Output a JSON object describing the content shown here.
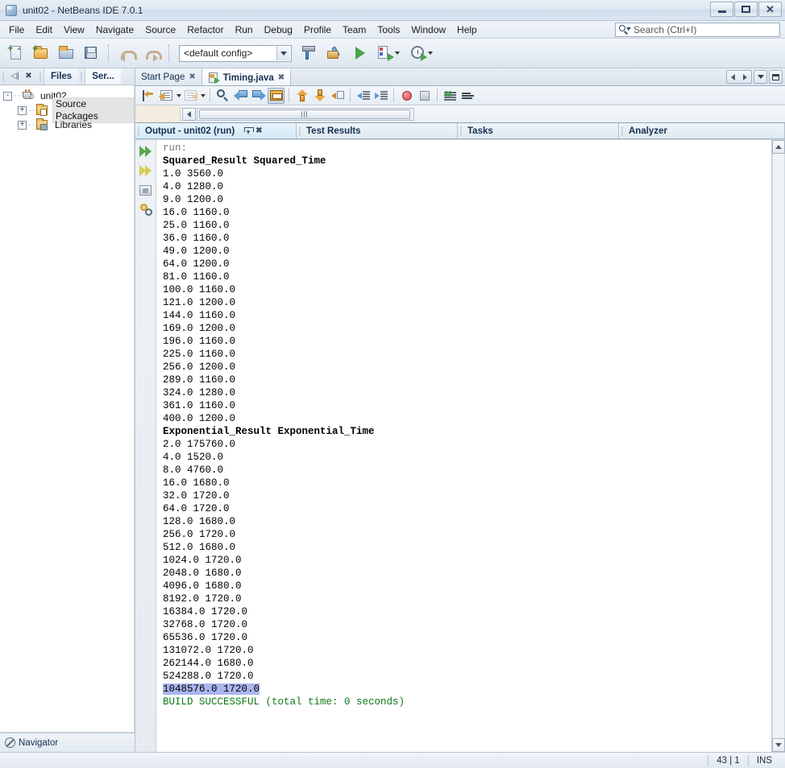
{
  "window": {
    "title": "unit02 - NetBeans IDE 7.0.1",
    "app_icon": "cube-icon",
    "controls": {
      "minimize": "minimize-button",
      "maximize": "maximize-button",
      "close": "✕"
    }
  },
  "menubar": {
    "items": [
      "File",
      "Edit",
      "View",
      "Navigate",
      "Source",
      "Refactor",
      "Run",
      "Debug",
      "Profile",
      "Team",
      "Tools",
      "Window",
      "Help"
    ],
    "search_placeholder": "Search (Ctrl+I)"
  },
  "toolbar": {
    "config_value": "<default config>",
    "buttons": [
      "new-file-icon",
      "new-project-icon",
      "open-project-icon",
      "save-all-icon",
      "undo-icon",
      "redo-icon",
      "build-project-icon",
      "clean-build-icon",
      "run-project-icon",
      "debug-project-icon",
      "profile-project-icon"
    ]
  },
  "explorer": {
    "tabs": [
      {
        "label": "Files",
        "active": false
      },
      {
        "label": "Ser...",
        "active": true
      }
    ],
    "tree": [
      {
        "label": "unit02",
        "icon": "java-project-icon",
        "expander": "-",
        "depth": 0,
        "selected": false
      },
      {
        "label": "Source Packages",
        "icon": "source-packages-icon",
        "expander": "+",
        "depth": 1,
        "selected": true
      },
      {
        "label": "Libraries",
        "icon": "libraries-icon",
        "expander": "+",
        "depth": 1,
        "selected": false
      }
    ]
  },
  "navigator": {
    "label": "Navigator",
    "icon": "no-navigator-icon"
  },
  "editor": {
    "tabs": [
      {
        "label": "Start Page",
        "active": false,
        "icon": ""
      },
      {
        "label": "Timing.java",
        "active": true,
        "icon": "java-file-icon"
      }
    ],
    "tab_nav": [
      "prev-tab-button",
      "next-tab-button",
      "tab-list-dropdown",
      "maximize-window-button"
    ],
    "toolbar_buttons": [
      "last-edit-icon",
      "back-icon",
      "forward-icon",
      "find-selection-icon",
      "previous-bookmark-icon",
      "next-bookmark-icon",
      "toggle-rectangular-selection-icon",
      "previous-error-icon",
      "next-error-icon",
      "toggle-bookmark-icon",
      "shift-left-icon",
      "shift-right-icon",
      "start-macro-recording-icon",
      "stop-macro-recording-icon",
      "inspect-members-icon",
      "inspect-hierarchy-icon"
    ]
  },
  "output_panel": {
    "tabs": [
      {
        "label": "Output - unit02 (run)",
        "active": true,
        "has_controls": true
      },
      {
        "label": "Test Results",
        "active": false,
        "has_controls": false
      },
      {
        "label": "Tasks",
        "active": false,
        "has_controls": false
      },
      {
        "label": "Analyzer",
        "active": false,
        "has_controls": false
      }
    ],
    "gutter_buttons": [
      "rerun-icon",
      "rerun-alt-icon",
      "stop-process-icon",
      "output-settings-icon"
    ],
    "lines": [
      {
        "text": "run:",
        "style": "muted"
      },
      {
        "text": "Squared_Result Squared_Time",
        "style": "bold"
      },
      {
        "text": "1.0 3560.0",
        "style": ""
      },
      {
        "text": "4.0 1280.0",
        "style": ""
      },
      {
        "text": "9.0 1200.0",
        "style": ""
      },
      {
        "text": "16.0 1160.0",
        "style": ""
      },
      {
        "text": "25.0 1160.0",
        "style": ""
      },
      {
        "text": "36.0 1160.0",
        "style": ""
      },
      {
        "text": "49.0 1200.0",
        "style": ""
      },
      {
        "text": "64.0 1200.0",
        "style": ""
      },
      {
        "text": "81.0 1160.0",
        "style": ""
      },
      {
        "text": "100.0 1160.0",
        "style": ""
      },
      {
        "text": "121.0 1200.0",
        "style": ""
      },
      {
        "text": "144.0 1160.0",
        "style": ""
      },
      {
        "text": "169.0 1200.0",
        "style": ""
      },
      {
        "text": "196.0 1160.0",
        "style": ""
      },
      {
        "text": "225.0 1160.0",
        "style": ""
      },
      {
        "text": "256.0 1200.0",
        "style": ""
      },
      {
        "text": "289.0 1160.0",
        "style": ""
      },
      {
        "text": "324.0 1280.0",
        "style": ""
      },
      {
        "text": "361.0 1160.0",
        "style": ""
      },
      {
        "text": "400.0 1200.0",
        "style": ""
      },
      {
        "text": "Exponential_Result Exponential_Time",
        "style": "bold"
      },
      {
        "text": "2.0 175760.0",
        "style": ""
      },
      {
        "text": "4.0 1520.0",
        "style": ""
      },
      {
        "text": "8.0 4760.0",
        "style": ""
      },
      {
        "text": "16.0 1680.0",
        "style": ""
      },
      {
        "text": "32.0 1720.0",
        "style": ""
      },
      {
        "text": "64.0 1720.0",
        "style": ""
      },
      {
        "text": "128.0 1680.0",
        "style": ""
      },
      {
        "text": "256.0 1720.0",
        "style": ""
      },
      {
        "text": "512.0 1680.0",
        "style": ""
      },
      {
        "text": "1024.0 1720.0",
        "style": ""
      },
      {
        "text": "2048.0 1680.0",
        "style": ""
      },
      {
        "text": "4096.0 1680.0",
        "style": ""
      },
      {
        "text": "8192.0 1720.0",
        "style": ""
      },
      {
        "text": "16384.0 1720.0",
        "style": ""
      },
      {
        "text": "32768.0 1720.0",
        "style": ""
      },
      {
        "text": "65536.0 1720.0",
        "style": ""
      },
      {
        "text": "131072.0 1720.0",
        "style": ""
      },
      {
        "text": "262144.0 1680.0",
        "style": ""
      },
      {
        "text": "524288.0 1720.0",
        "style": ""
      },
      {
        "text": "1048576.0 1720.0",
        "style": "selected"
      },
      {
        "text": "BUILD SUCCESSFUL (total time: 0 seconds)",
        "style": "green"
      }
    ]
  },
  "statusbar": {
    "cursor_position": "43 | 1",
    "insert_mode": "INS"
  },
  "colors": {
    "selection": "#aab6f0",
    "success_text": "#0f7a16",
    "accent": "#4ca24c"
  }
}
